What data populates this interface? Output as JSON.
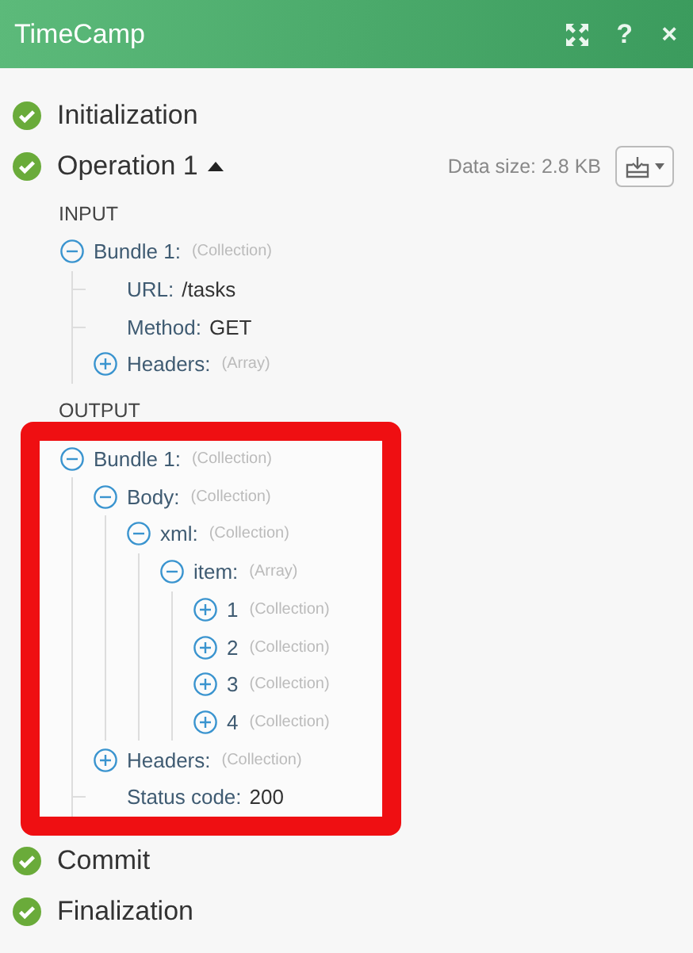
{
  "window": {
    "title": "TimeCamp",
    "buttons": [
      "?",
      "×"
    ]
  },
  "steps": [
    {
      "label": "Initialization",
      "completed": true
    },
    {
      "label": "Operation 1",
      "completed": true,
      "expanded": true,
      "data_size": "Data size: 2.8 KB",
      "sections": [
        {
          "title": "INPUT",
          "highlighted": false,
          "tree": [
            {
              "label": "Bundle 1:",
              "type": "(Collection)",
              "expanded": true,
              "children": [
                {
                  "label": "URL:",
                  "value": "/tasks"
                },
                {
                  "label": "Method:",
                  "value": "GET"
                },
                {
                  "label": "Headers:",
                  "type": "(Array)",
                  "expanded": false
                }
              ]
            }
          ]
        },
        {
          "title": "OUTPUT",
          "highlighted": true,
          "tree": [
            {
              "label": "Bundle 1:",
              "type": "(Collection)",
              "expanded": true,
              "children": [
                {
                  "label": "Body:",
                  "type": "(Collection)",
                  "expanded": true,
                  "children": [
                    {
                      "label": "xml:",
                      "type": "(Collection)",
                      "expanded": true,
                      "children": [
                        {
                          "label": "item:",
                          "type": "(Array)",
                          "expanded": true,
                          "children": [
                            {
                              "label": "1",
                              "type": "(Collection)",
                              "expanded": false
                            },
                            {
                              "label": "2",
                              "type": "(Collection)",
                              "expanded": false
                            },
                            {
                              "label": "3",
                              "type": "(Collection)",
                              "expanded": false
                            },
                            {
                              "label": "4",
                              "type": "(Collection)",
                              "expanded": false
                            }
                          ]
                        }
                      ]
                    }
                  ]
                },
                {
                  "label": "Headers:",
                  "type": "(Collection)",
                  "expanded": false
                },
                {
                  "label": "Status code:",
                  "value": "200"
                }
              ]
            }
          ]
        }
      ]
    },
    {
      "label": "Commit",
      "completed": true
    },
    {
      "label": "Finalization",
      "completed": true
    }
  ]
}
